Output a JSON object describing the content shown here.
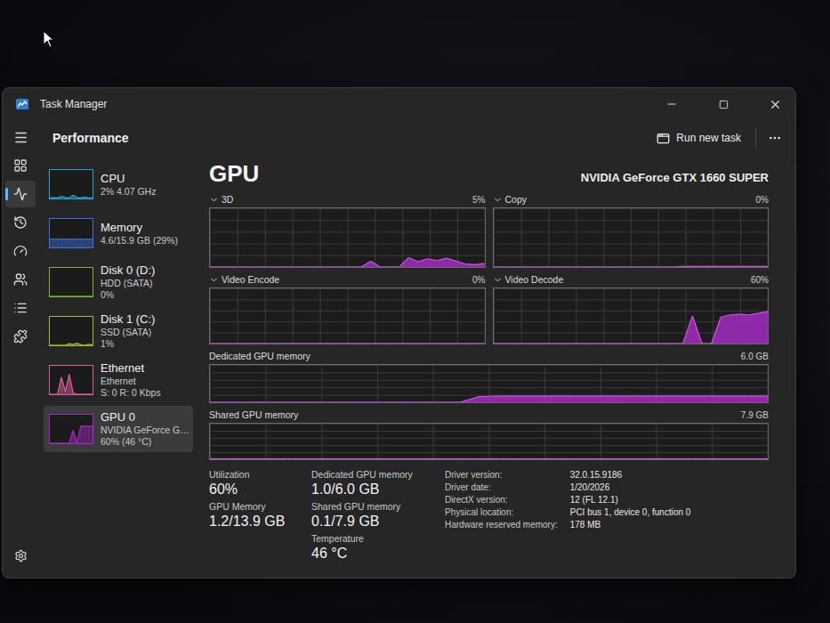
{
  "window": {
    "title": "Task Manager"
  },
  "header": {
    "title": "Performance",
    "run_button": "Run new task"
  },
  "nav": [
    {
      "selected": false
    },
    {
      "selected": true
    },
    {
      "selected": false
    },
    {
      "selected": false
    },
    {
      "selected": false
    },
    {
      "selected": false
    },
    {
      "selected": false
    }
  ],
  "devices": [
    {
      "name": "CPU",
      "lines": [
        "2% 4.07 GHz"
      ],
      "color": "#2a9fd6",
      "selected": false,
      "graph": [
        2,
        3,
        2,
        8,
        3,
        2,
        12,
        3,
        2,
        5,
        2,
        2
      ]
    },
    {
      "name": "Memory",
      "lines": [
        "4.6/15.9 GB (29%)"
      ],
      "color": "#3d6fd8",
      "selected": false,
      "graph": [
        29,
        29,
        29,
        29,
        29,
        29,
        29,
        29,
        29,
        29,
        29,
        29
      ]
    },
    {
      "name": "Disk 0 (D:)",
      "lines": [
        "HDD (SATA)",
        "0%"
      ],
      "color": "#7fb33a",
      "selected": false,
      "graph": [
        0,
        0,
        0,
        0,
        0,
        0,
        0,
        0,
        0,
        0,
        0,
        0
      ]
    },
    {
      "name": "Disk 1 (C:)",
      "lines": [
        "SSD (SATA)",
        "1%"
      ],
      "color": "#9bbf2f",
      "selected": false,
      "graph": [
        0,
        0,
        0,
        0,
        0,
        6,
        3,
        8,
        2,
        0,
        4,
        1
      ]
    },
    {
      "name": "Ethernet",
      "lines": [
        "Ethernet",
        "S: 0 R: 0 Kbps"
      ],
      "color": "#d6609c",
      "selected": false,
      "graph": [
        0,
        0,
        0,
        60,
        10,
        70,
        5,
        0,
        0,
        0,
        0,
        0
      ]
    },
    {
      "name": "GPU 0",
      "lines": [
        "NVIDIA GeForce G…",
        "60% (46 °C)"
      ],
      "color": "#a42cc4",
      "selected": true,
      "graph": [
        0,
        0,
        0,
        0,
        0,
        0,
        45,
        0,
        60,
        60,
        60,
        60
      ]
    }
  ],
  "detail": {
    "title": "GPU",
    "model": "NVIDIA GeForce GTX 1660 SUPER",
    "engines": [
      {
        "label": "3D",
        "reading": "5%",
        "axis_max": 100,
        "values": [
          0,
          0,
          0,
          0,
          0,
          0,
          0,
          0,
          0,
          0,
          0,
          0,
          0,
          0,
          0,
          0,
          0,
          10,
          0,
          0,
          0,
          16,
          9,
          14,
          11,
          15,
          10,
          5,
          4,
          6
        ]
      },
      {
        "label": "Copy",
        "reading": "0%",
        "axis_max": 100,
        "values": [
          0,
          0,
          0,
          0,
          0,
          0,
          0,
          0,
          0,
          0,
          0,
          0,
          0,
          0,
          0,
          0,
          0,
          0,
          0,
          0,
          1,
          1,
          1,
          1,
          1,
          1,
          1,
          1,
          1,
          1
        ]
      },
      {
        "label": "Video Encode",
        "reading": "0%",
        "axis_max": 100,
        "values": [
          0,
          0,
          0,
          0,
          0,
          0,
          0,
          0,
          0,
          0,
          0,
          0,
          0,
          0,
          0,
          0,
          0,
          0,
          0,
          0,
          0,
          0,
          0,
          0,
          0,
          0,
          0,
          0,
          0,
          0
        ]
      },
      {
        "label": "Video Decode",
        "reading": "60%",
        "axis_max": 100,
        "values": [
          0,
          0,
          0,
          0,
          0,
          0,
          0,
          0,
          0,
          0,
          0,
          0,
          0,
          0,
          0,
          0,
          0,
          0,
          0,
          0,
          0,
          50,
          0,
          0,
          48,
          52,
          53,
          52,
          55,
          58
        ]
      }
    ],
    "memory_charts": [
      {
        "label": "Dedicated GPU memory",
        "reading": "6.0 GB",
        "axis_max": 6,
        "values": [
          0,
          0,
          0,
          0,
          0,
          0,
          0,
          0,
          0,
          0,
          0,
          0,
          0,
          0,
          0.9,
          1.0,
          1.0,
          1.0,
          1.0,
          1.0,
          1.0,
          1.0,
          1.0,
          1.0,
          1.0,
          1.0,
          1.0,
          1.0,
          1.0,
          1.0
        ]
      },
      {
        "label": "Shared GPU memory",
        "reading": "7.9 GB",
        "axis_max": 7.9,
        "values": [
          0.1,
          0.1,
          0.1,
          0.1,
          0.1,
          0.1,
          0.1,
          0.1,
          0.1,
          0.1,
          0.1,
          0.1,
          0.1,
          0.1,
          0.1,
          0.1,
          0.1,
          0.1,
          0.1,
          0.1,
          0.1,
          0.1,
          0.1,
          0.1,
          0.1,
          0.1,
          0.1,
          0.1,
          0.1,
          0.1
        ]
      }
    ],
    "stat_columns": [
      [
        {
          "label": "Utilization",
          "value": "60%"
        },
        {
          "label": "GPU Memory",
          "value": "1.2/13.9 GB"
        }
      ],
      [
        {
          "label": "Dedicated GPU memory",
          "value": "1.0/6.0 GB"
        },
        {
          "label": "Shared GPU memory",
          "value": "0.1/7.9 GB"
        },
        {
          "label": "Temperature",
          "value": "46 °C"
        }
      ]
    ],
    "info": [
      {
        "label": "Driver version:",
        "value": "32.0.15.9186"
      },
      {
        "label": "Driver date:",
        "value": "1/20/2026"
      },
      {
        "label": "DirectX version:",
        "value": "12 (FL 12.1)"
      },
      {
        "label": "Physical location:",
        "value": "PCI bus 1, device 0, function 0"
      },
      {
        "label": "Hardware reserved memory:",
        "value": "178 MB"
      }
    ]
  }
}
